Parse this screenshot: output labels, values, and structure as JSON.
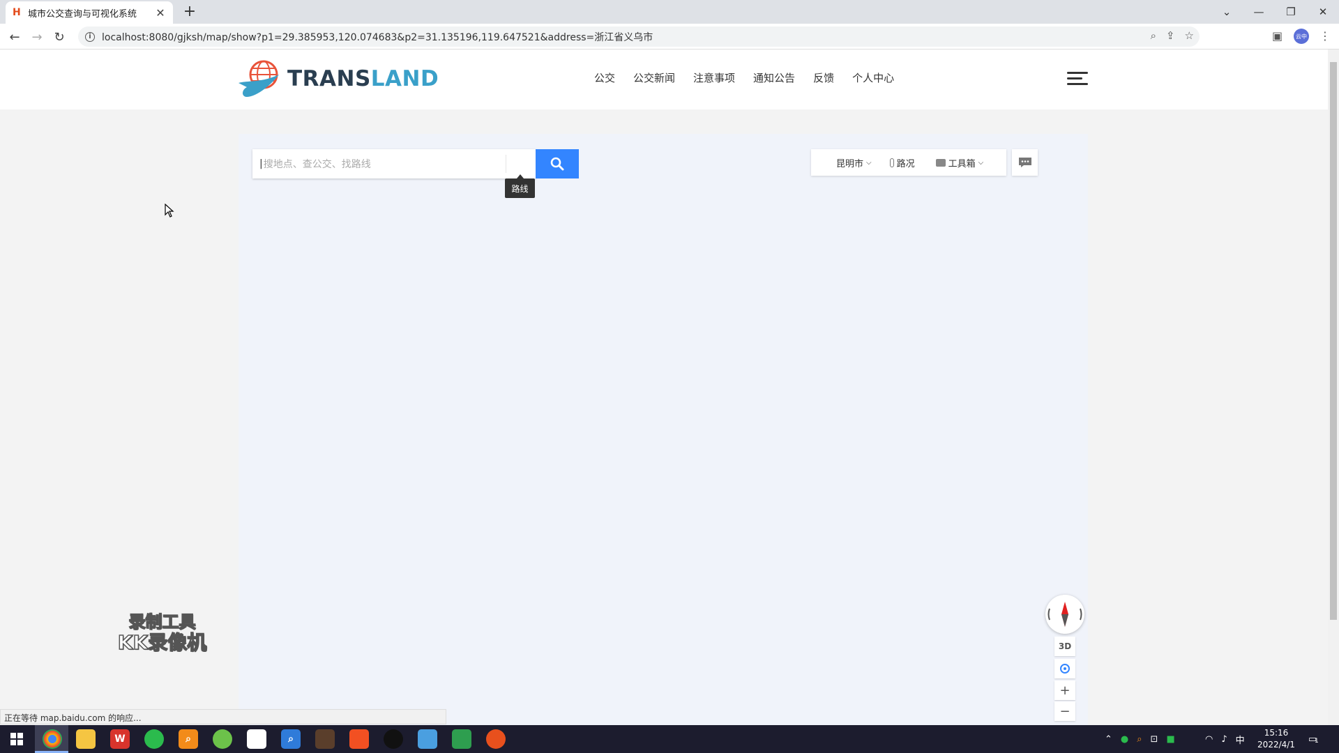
{
  "browser": {
    "tab_title": "城市公交查询与可视化系统",
    "tab_favicon": "H",
    "url": "localhost:8080/gjksh/map/show?p1=29.385953,120.074683&p2=31.135196,119.647521&address=浙江省义乌市",
    "profile_label": "云中",
    "status_text": "正在等待 map.baidu.com 的响应..."
  },
  "site": {
    "logo_part1": "TRANS",
    "logo_part2": "LAND",
    "nav": [
      "公交",
      "公交新闻",
      "注意事项",
      "通知公告",
      "反馈",
      "个人中心"
    ]
  },
  "map": {
    "search_placeholder": "搜地点、查公交、找路线",
    "route_tooltip": "路线",
    "city": "昆明市",
    "traffic_label": "路况",
    "toolbox_label": "工具箱",
    "ctrl_3d": "3D",
    "zoom_in": "+",
    "zoom_out": "−"
  },
  "watermark": {
    "line1": "录制工具",
    "line2": "KK录像机"
  },
  "taskbar": {
    "time": "15:16",
    "date": "2022/4/1",
    "ime": "中",
    "notifications": "1"
  },
  "colors": {
    "accent_blue": "#3385ff",
    "logo_dark": "#2a3e50",
    "logo_light": "#3aa0c9",
    "map_bg": "#f0f3fa"
  }
}
